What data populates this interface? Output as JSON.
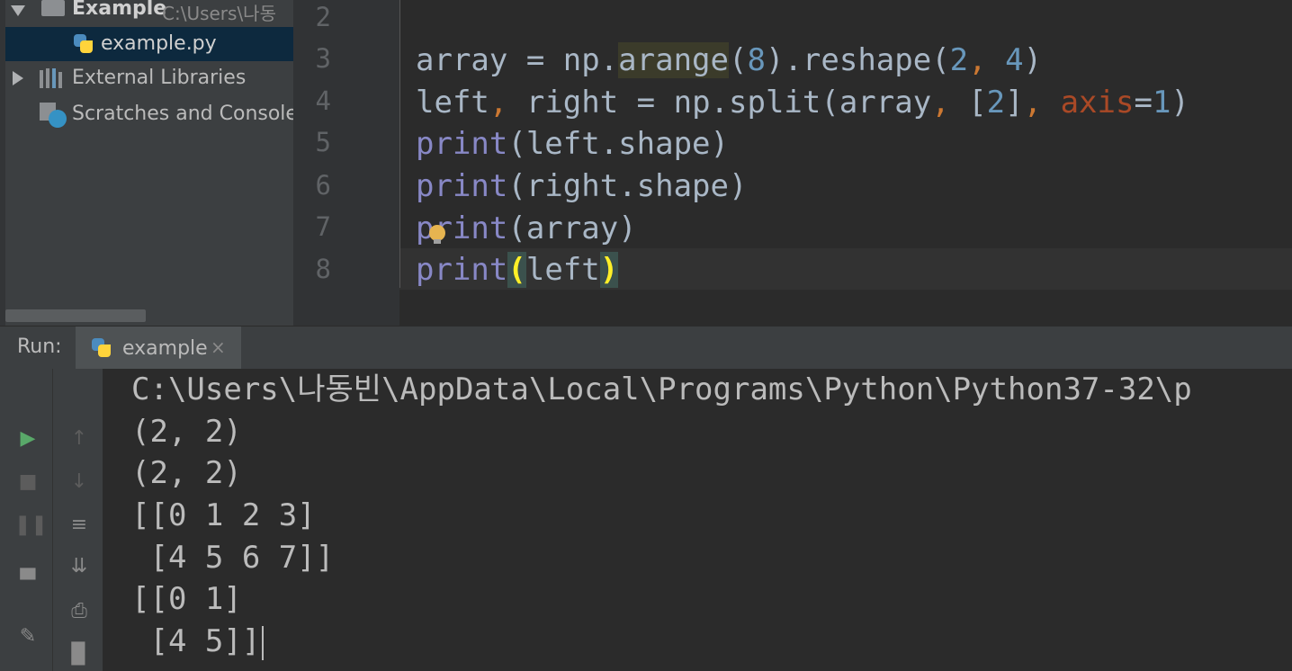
{
  "project_tree": {
    "root": {
      "name": "Example",
      "path": "C:\\Users\\나동"
    },
    "file": {
      "name": "example.py"
    },
    "external_libraries": "External Libraries",
    "scratches": "Scratches and Consoles"
  },
  "editor": {
    "line_numbers": [
      "2",
      "3",
      "4",
      "5",
      "6",
      "7",
      "8"
    ],
    "lines": {
      "l3": {
        "a": "array = np.",
        "b": "arange",
        "c": "(",
        "d": "8",
        "e": ").reshape(",
        "f": "2",
        "g": ", ",
        "h": "4",
        "i": ")"
      },
      "l4": {
        "a": "left",
        "b": ",",
        "c": " right = np.split(array",
        "d": ",",
        "e": " [",
        "f": "2",
        "g": "]",
        "h": ",",
        "i": " ",
        "j": "axis",
        "k": "=",
        "l": "1",
        "m": ")"
      },
      "l5": {
        "a": "print",
        "b": "(left.shape)"
      },
      "l6": {
        "a": "print",
        "b": "(right.shape)"
      },
      "l7": {
        "a": "print",
        "b": "(array)"
      },
      "l8": {
        "a": "print",
        "b": "(",
        "c": "left",
        "d": ")"
      }
    }
  },
  "run_window": {
    "label": "Run:",
    "tab_title": "example",
    "tab_close": "×",
    "output": [
      "C:\\Users\\나동빈\\AppData\\Local\\Programs\\Python\\Python37-32\\p",
      "(2, 2)",
      "(2, 2)",
      "[[0 1 2 3]",
      " [4 5 6 7]]",
      "[[0 1]",
      " [4 5]]"
    ]
  },
  "colors": {
    "editor_bg": "#2b2b2b",
    "panel_bg": "#3c3f41",
    "selection": "#0d293e",
    "builtin": "#8888c6",
    "number": "#6897bb",
    "comma": "#cc7832",
    "param": "#aa4926",
    "run_green": "#59a869"
  }
}
